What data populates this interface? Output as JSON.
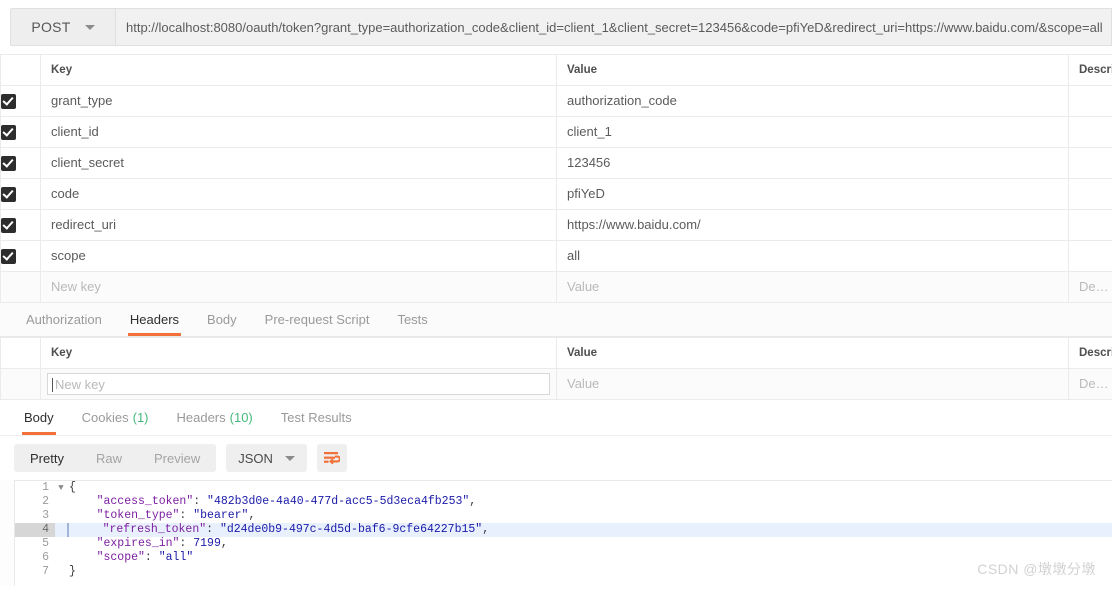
{
  "request": {
    "method": "POST",
    "url": "http://localhost:8080/oauth/token?grant_type=authorization_code&client_id=client_1&client_secret=123456&code=pfiYeD&redirect_uri=https://www.baidu.com/&scope=all"
  },
  "params_table": {
    "headers": {
      "key": "Key",
      "value": "Value",
      "description": "Descrip"
    },
    "rows": [
      {
        "checked": true,
        "key": "grant_type",
        "value": "authorization_code",
        "description": ""
      },
      {
        "checked": true,
        "key": "client_id",
        "value": "client_1",
        "description": ""
      },
      {
        "checked": true,
        "key": "client_secret",
        "value": "123456",
        "description": ""
      },
      {
        "checked": true,
        "key": "code",
        "value": "pfiYeD",
        "description": ""
      },
      {
        "checked": true,
        "key": "redirect_uri",
        "value": "https://www.baidu.com/",
        "description": ""
      },
      {
        "checked": true,
        "key": "scope",
        "value": "all",
        "description": ""
      }
    ],
    "new_row": {
      "key_placeholder": "New key",
      "value_placeholder": "Value",
      "description_placeholder": "Descri"
    }
  },
  "request_tabs": {
    "items": [
      {
        "label": "Authorization",
        "active": false
      },
      {
        "label": "Headers",
        "active": true
      },
      {
        "label": "Body",
        "active": false
      },
      {
        "label": "Pre-request Script",
        "active": false
      },
      {
        "label": "Tests",
        "active": false
      }
    ]
  },
  "headers_table": {
    "headers": {
      "key": "Key",
      "value": "Value",
      "description": "Descrip"
    },
    "new_row": {
      "key_placeholder": "New key",
      "value_placeholder": "Value",
      "description_placeholder": "Descri"
    }
  },
  "response_tabs": {
    "items": [
      {
        "label": "Body",
        "count": "",
        "active": true
      },
      {
        "label": "Cookies",
        "count": "(1)",
        "active": false
      },
      {
        "label": "Headers",
        "count": "(10)",
        "active": false
      },
      {
        "label": "Test Results",
        "count": "",
        "active": false
      }
    ]
  },
  "format_bar": {
    "modes": [
      {
        "label": "Pretty",
        "active": true
      },
      {
        "label": "Raw",
        "active": false
      },
      {
        "label": "Preview",
        "active": false
      }
    ],
    "language": "JSON",
    "wrap_icon": "word-wrap-icon"
  },
  "response_body": {
    "lines": [
      {
        "number": "1",
        "foldable": true,
        "highlight": false,
        "tokens": [
          {
            "t": "punct",
            "s": "{"
          }
        ]
      },
      {
        "number": "2",
        "foldable": false,
        "highlight": false,
        "tokens": [
          {
            "t": "key",
            "s": "    \"access_token\""
          },
          {
            "t": "punct",
            "s": ": "
          },
          {
            "t": "str",
            "s": "\"482b3d0e-4a40-477d-acc5-5d3eca4fb253\""
          },
          {
            "t": "punct",
            "s": ","
          }
        ]
      },
      {
        "number": "3",
        "foldable": false,
        "highlight": false,
        "tokens": [
          {
            "t": "key",
            "s": "    \"token_type\""
          },
          {
            "t": "punct",
            "s": ": "
          },
          {
            "t": "str",
            "s": "\"bearer\""
          },
          {
            "t": "punct",
            "s": ","
          }
        ]
      },
      {
        "number": "4",
        "foldable": false,
        "highlight": true,
        "tokens": [
          {
            "t": "key",
            "s": "    \"refresh_token\""
          },
          {
            "t": "punct",
            "s": ": "
          },
          {
            "t": "str",
            "s": "\"d24de0b9-497c-4d5d-baf6-9cfe64227b15\""
          },
          {
            "t": "punct",
            "s": ","
          }
        ]
      },
      {
        "number": "5",
        "foldable": false,
        "highlight": false,
        "tokens": [
          {
            "t": "key",
            "s": "    \"expires_in\""
          },
          {
            "t": "punct",
            "s": ": "
          },
          {
            "t": "num",
            "s": "7199"
          },
          {
            "t": "punct",
            "s": ","
          }
        ]
      },
      {
        "number": "6",
        "foldable": false,
        "highlight": false,
        "tokens": [
          {
            "t": "key",
            "s": "    \"scope\""
          },
          {
            "t": "punct",
            "s": ": "
          },
          {
            "t": "str",
            "s": "\"all\""
          }
        ]
      },
      {
        "number": "7",
        "foldable": false,
        "highlight": false,
        "tokens": [
          {
            "t": "punct",
            "s": "}"
          }
        ]
      }
    ]
  },
  "watermark": {
    "text": "CSDN @墩墩分墩"
  },
  "colors": {
    "accent": "#f2713a",
    "count_green": "#45b97c",
    "checkbox": "#2d2d2d",
    "highlight_row": "#e8f0fe"
  }
}
